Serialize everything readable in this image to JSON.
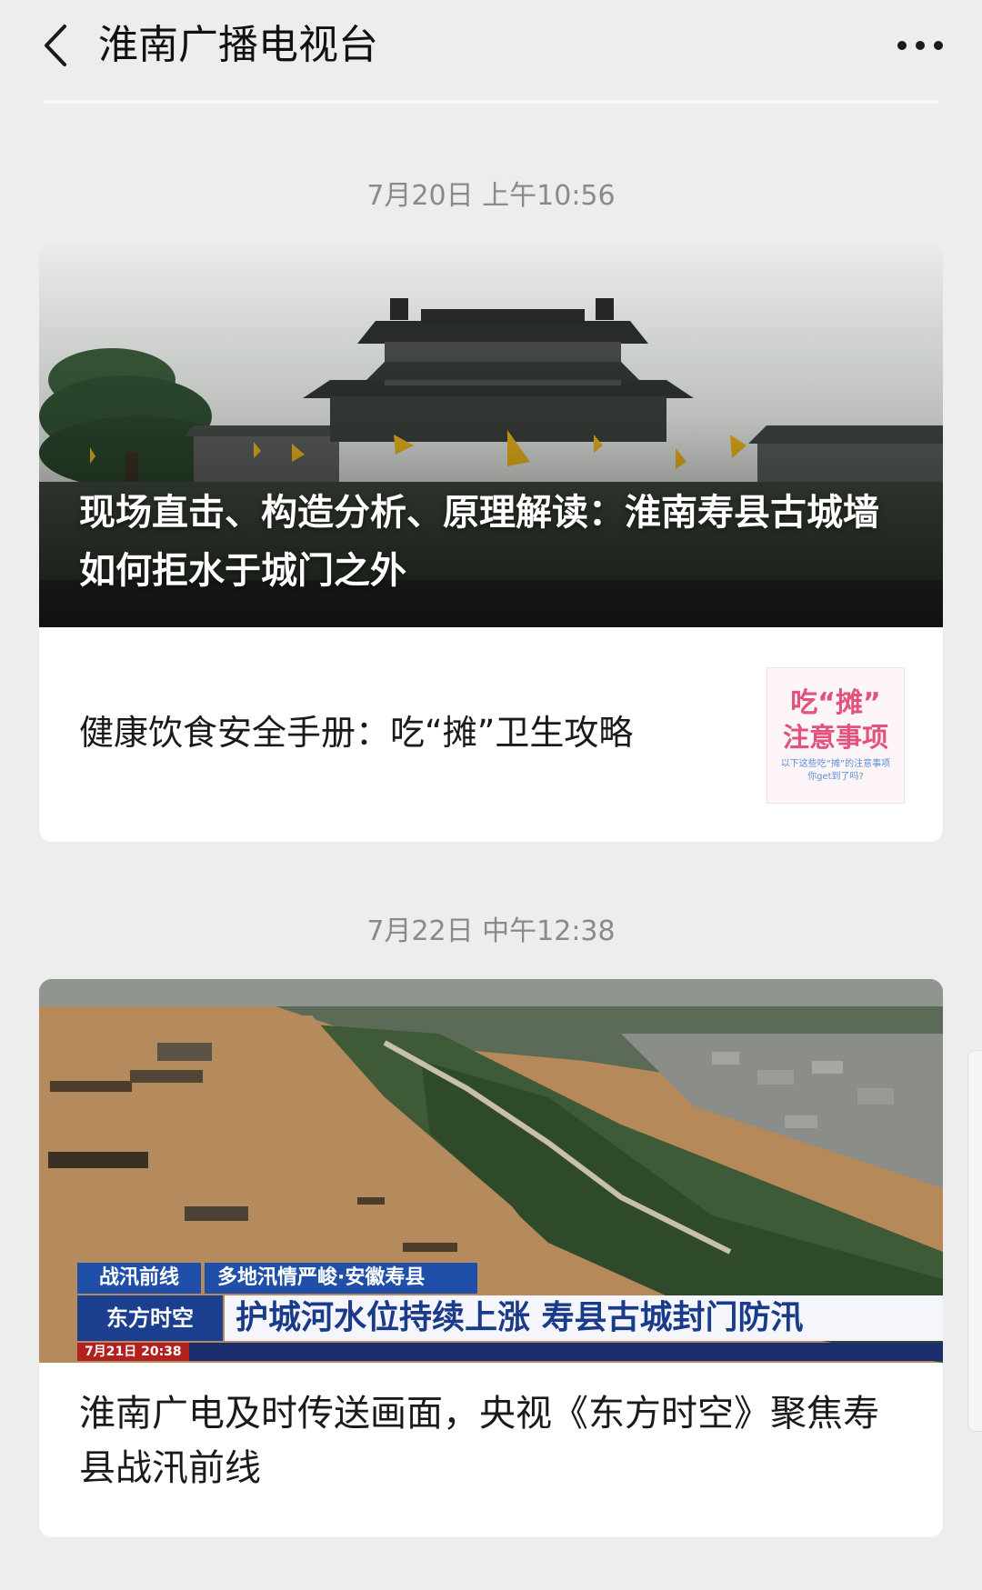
{
  "header": {
    "title": "淮南广播电视台",
    "back_icon": "chevron-left-icon",
    "more_icon": "more-horizontal-icon"
  },
  "messages": [
    {
      "timestamp": "7月20日 上午10:56",
      "main_article": {
        "title": "现场直击、构造分析、原理解读：淮南寿县古城墙如何拒水于城门之外"
      },
      "sub_article": {
        "title": "健康饮食安全手册：吃“摊”卫生攻略",
        "thumbnail": {
          "line1": "吃“摊”",
          "line2": "注意事项",
          "line3": "以下这些吃“摊”的注意事项",
          "line4": "你get到了吗?"
        }
      }
    },
    {
      "timestamp": "7月22日 中午12:38",
      "main_article": {
        "title": "淮南广电及时传送画面，央视《东方时空》聚焦寿县战汛前线",
        "banner": {
          "tag_top": "战汛前线",
          "subheadline": "多地汛情严峻·安徽寿县",
          "tag_bottom": "东方时空",
          "headline": "护城河水位持续上涨 寿县古城封门防汛",
          "ticker_date": "7月21日 20:38"
        }
      }
    }
  ],
  "colors": {
    "background": "#ededed",
    "card": "#ffffff",
    "timestamp_text": "#8a8a8a",
    "banner_blue": "#1f4fa8",
    "thumb_pink": "#e2527a"
  }
}
